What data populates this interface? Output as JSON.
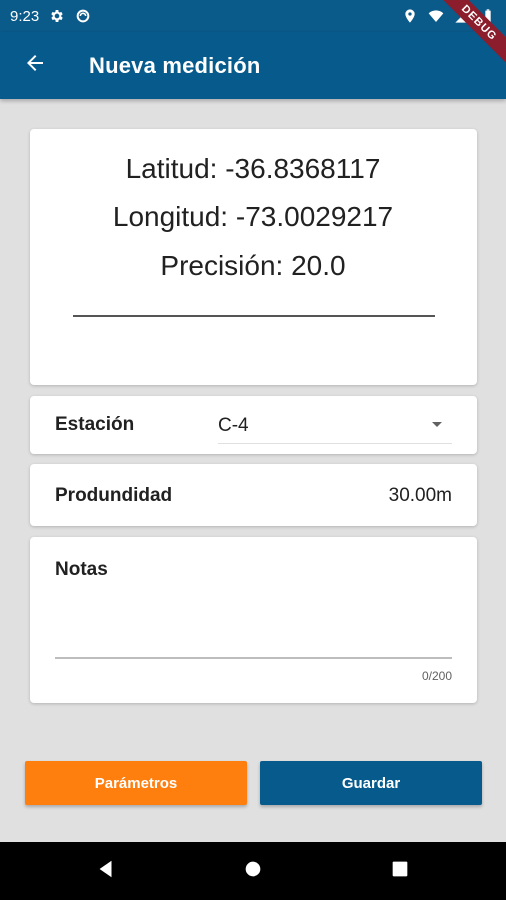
{
  "status_bar": {
    "time": "9:23",
    "icons_left": [
      "gear-icon",
      "sync-icon"
    ],
    "icons_right": [
      "location-icon",
      "wifi-icon",
      "signal-icon",
      "battery-icon"
    ]
  },
  "app_bar": {
    "title": "Nueva medición",
    "back_icon": "arrow-back-icon",
    "background": "#065b8c"
  },
  "debug_banner": "DEBUG",
  "coordinates": {
    "latitude": "Latitud: -36.8368117",
    "longitude": "Longitud: -73.0029217",
    "precision": "Precisión: 20.0"
  },
  "station": {
    "label": "Estación",
    "value": "C-4"
  },
  "depth": {
    "label": "Produndidad",
    "value": "30.00m"
  },
  "notes": {
    "label": "Notas",
    "value": "",
    "counter": "0/200"
  },
  "buttons": {
    "params_label": "Parámetros",
    "save_label": "Guardar",
    "params_color": "#ff7f0e",
    "save_color": "#065b8c"
  },
  "nav_bar": {
    "icons": [
      "nav-back-icon",
      "nav-home-icon",
      "nav-recent-icon"
    ]
  }
}
